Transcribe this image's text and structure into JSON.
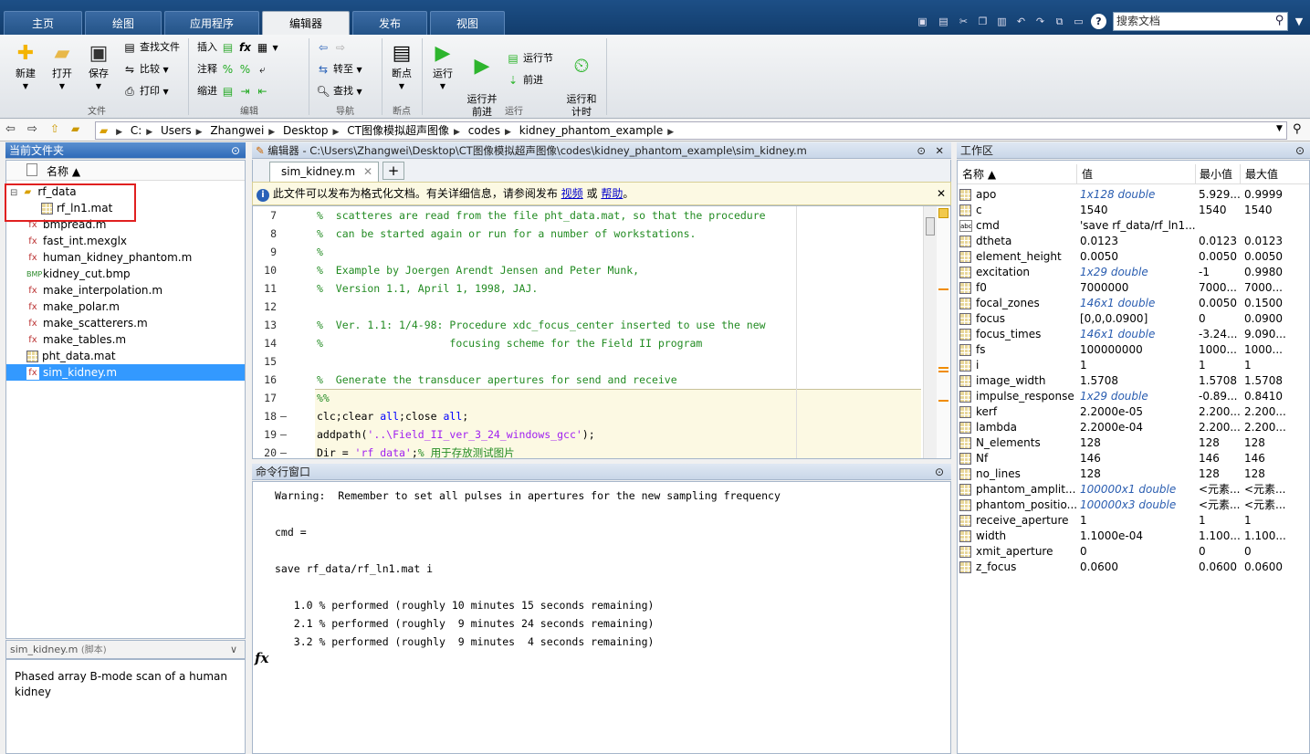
{
  "tabs": [
    "主页",
    "绘图",
    "应用程序",
    "编辑器",
    "发布",
    "视图"
  ],
  "active_tab": "编辑器",
  "search": {
    "placeholder": "搜索文档"
  },
  "ribbon": {
    "file_group": {
      "label": "文件",
      "new": "新建",
      "open": "打开",
      "save": "保存",
      "find_files": "查找文件",
      "compare": "比较",
      "print": "打印"
    },
    "edit_group": {
      "label": "编辑",
      "insert": "插入",
      "comment": "注释",
      "indent": "缩进"
    },
    "nav_group": {
      "label": "导航",
      "goto": "转至",
      "find": "查找"
    },
    "breakpoint_group": {
      "label": "断点",
      "breakpoints": "断点"
    },
    "run_group": {
      "label": "运行",
      "run": "运行",
      "run_advance": "运行并\n前进",
      "run_section": "运行节",
      "advance": "前进",
      "run_time": "运行和\n计时"
    }
  },
  "address": {
    "crumbs": [
      "C:",
      "Users",
      "Zhangwei",
      "Desktop",
      "CT图像模拟超声图像",
      "codes",
      "kidney_phantom_example"
    ]
  },
  "current_folder": {
    "title": "当前文件夹",
    "col_name": "名称 ▲",
    "files": [
      {
        "name": "rf_data",
        "type": "folder"
      },
      {
        "name": "rf_ln1.mat",
        "type": "mat"
      },
      {
        "name": "bmpread.m",
        "type": "m"
      },
      {
        "name": "fast_int.mexglx",
        "type": "mex"
      },
      {
        "name": "human_kidney_phantom.m",
        "type": "m"
      },
      {
        "name": "kidney_cut.bmp",
        "type": "bmp"
      },
      {
        "name": "make_interpolation.m",
        "type": "m"
      },
      {
        "name": "make_polar.m",
        "type": "m"
      },
      {
        "name": "make_scatterers.m",
        "type": "m"
      },
      {
        "name": "make_tables.m",
        "type": "m"
      },
      {
        "name": "pht_data.mat",
        "type": "mat"
      },
      {
        "name": "sim_kidney.m",
        "type": "m"
      }
    ],
    "details_title": "sim_kidney.m",
    "details_kind": "(脚本)",
    "details_text": "Phased array B-mode scan of a human kidney"
  },
  "editor": {
    "title": "编辑器 - C:\\Users\\Zhangwei\\Desktop\\CT图像模拟超声图像\\codes\\kidney_phantom_example\\sim_kidney.m",
    "file_tab": "sim_kidney.m",
    "info_prefix": "此文件可以发布为格式化文档。有关详细信息，请参阅发布",
    "info_link1": "视频",
    "info_or": "或",
    "info_link2": "帮助",
    "info_suffix": "。",
    "lines": [
      {
        "n": "7",
        "d": "",
        "t": "%  scatteres are read from the file pht_data.mat, so that the procedure",
        "c": "cmt"
      },
      {
        "n": "8",
        "d": "",
        "t": "%  can be started again or run for a number of workstations.",
        "c": "cmt"
      },
      {
        "n": "9",
        "d": "",
        "t": "%",
        "c": "cmt"
      },
      {
        "n": "10",
        "d": "",
        "t": "%  Example by Joergen Arendt Jensen and Peter Munk,",
        "c": "cmt"
      },
      {
        "n": "11",
        "d": "",
        "t": "%  Version 1.1, April 1, 1998, JAJ.",
        "c": "cmt"
      },
      {
        "n": "12",
        "d": "",
        "t": "",
        "c": ""
      },
      {
        "n": "13",
        "d": "",
        "t": "%  Ver. 1.1: 1/4-98: Procedure xdc_focus_center inserted to use the new",
        "c": "cmt"
      },
      {
        "n": "14",
        "d": "",
        "t": "%                    focusing scheme for the Field II program",
        "c": "cmt"
      },
      {
        "n": "15",
        "d": "",
        "t": "",
        "c": ""
      },
      {
        "n": "16",
        "d": "",
        "t": "%  Generate the transducer apertures for send and receive",
        "c": "cmt"
      },
      {
        "n": "17",
        "d": "",
        "t": "%%",
        "c": "cmt"
      },
      {
        "n": "18",
        "d": "–",
        "t": "clc;clear all;close all;",
        "c": "mix1"
      },
      {
        "n": "19",
        "d": "–",
        "t": "addpath('..\\Field_II_ver_3_24_windows_gcc');",
        "c": "mix2"
      },
      {
        "n": "20",
        "d": "–",
        "t": "Dir = 'rf_data';% 用于存放测试图片",
        "c": "mix3"
      }
    ]
  },
  "command_window": {
    "title": "命令行窗口",
    "lines": [
      "Warning:  Remember to set all pulses in apertures for the new sampling frequency",
      "",
      "cmd =",
      "",
      "save rf_data/rf_ln1.mat i",
      "",
      "   1.0 % performed (roughly 10 minutes 15 seconds remaining)",
      "   2.1 % performed (roughly  9 minutes 24 seconds remaining)",
      "   3.2 % performed (roughly  9 minutes  4 seconds remaining)"
    ],
    "prompt": "fx"
  },
  "workspace": {
    "title": "工作区",
    "cols": [
      "名称 ▲",
      "值",
      "最小值",
      "最大值"
    ],
    "vars": [
      {
        "name": "apo",
        "value": "1x128 double",
        "min": "5.929...",
        "max": "0.9999",
        "link": true
      },
      {
        "name": "c",
        "value": "1540",
        "min": "1540",
        "max": "1540",
        "link": false
      },
      {
        "name": "cmd",
        "value": "'save rf_data/rf_ln1....",
        "min": "",
        "max": "",
        "link": false,
        "icon": "abc"
      },
      {
        "name": "dtheta",
        "value": "0.0123",
        "min": "0.0123",
        "max": "0.0123",
        "link": false
      },
      {
        "name": "element_height",
        "value": "0.0050",
        "min": "0.0050",
        "max": "0.0050",
        "link": false
      },
      {
        "name": "excitation",
        "value": "1x29 double",
        "min": "-1",
        "max": "0.9980",
        "link": true
      },
      {
        "name": "f0",
        "value": "7000000",
        "min": "7000...",
        "max": "7000...",
        "link": false
      },
      {
        "name": "focal_zones",
        "value": "146x1 double",
        "min": "0.0050",
        "max": "0.1500",
        "link": true
      },
      {
        "name": "focus",
        "value": "[0,0,0.0900]",
        "min": "0",
        "max": "0.0900",
        "link": false
      },
      {
        "name": "focus_times",
        "value": "146x1 double",
        "min": "-3.24...",
        "max": "9.090...",
        "link": true
      },
      {
        "name": "fs",
        "value": "100000000",
        "min": "1000...",
        "max": "1000...",
        "link": false
      },
      {
        "name": "i",
        "value": "1",
        "min": "1",
        "max": "1",
        "link": false
      },
      {
        "name": "image_width",
        "value": "1.5708",
        "min": "1.5708",
        "max": "1.5708",
        "link": false
      },
      {
        "name": "impulse_response",
        "value": "1x29 double",
        "min": "-0.89...",
        "max": "0.8410",
        "link": true
      },
      {
        "name": "kerf",
        "value": "2.2000e-05",
        "min": "2.200...",
        "max": "2.200...",
        "link": false
      },
      {
        "name": "lambda",
        "value": "2.2000e-04",
        "min": "2.200...",
        "max": "2.200...",
        "link": false
      },
      {
        "name": "N_elements",
        "value": "128",
        "min": "128",
        "max": "128",
        "link": false
      },
      {
        "name": "Nf",
        "value": "146",
        "min": "146",
        "max": "146",
        "link": false
      },
      {
        "name": "no_lines",
        "value": "128",
        "min": "128",
        "max": "128",
        "link": false
      },
      {
        "name": "phantom_amplit...",
        "value": "100000x1 double",
        "min": "<元素...",
        "max": "<元素...",
        "link": true
      },
      {
        "name": "phantom_positio...",
        "value": "100000x3 double",
        "min": "<元素...",
        "max": "<元素...",
        "link": true
      },
      {
        "name": "receive_aperture",
        "value": "1",
        "min": "1",
        "max": "1",
        "link": false
      },
      {
        "name": "width",
        "value": "1.1000e-04",
        "min": "1.100...",
        "max": "1.100...",
        "link": false
      },
      {
        "name": "xmit_aperture",
        "value": "0",
        "min": "0",
        "max": "0",
        "link": false
      },
      {
        "name": "z_focus",
        "value": "0.0600",
        "min": "0.0600",
        "max": "0.0600",
        "link": false
      }
    ]
  },
  "colors": {
    "accent": "#1d4f86",
    "selection": "#3399ff",
    "highlight_red": "#e02020",
    "cell_bg": "#fcf9e3"
  }
}
